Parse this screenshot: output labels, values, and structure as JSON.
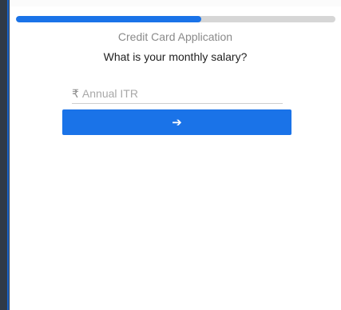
{
  "progress": {
    "fraction": 0.58
  },
  "header": {
    "app_title": "Credit Card Application",
    "question": "What is your monthly salary?"
  },
  "salary_field": {
    "currency_symbol": "₹",
    "placeholder": "Annual ITR",
    "value": ""
  },
  "next_button": {
    "icon": "arrow-right-icon",
    "glyph": "➔"
  },
  "colors": {
    "accent": "#1a73e8",
    "track": "#d6d6d6"
  }
}
